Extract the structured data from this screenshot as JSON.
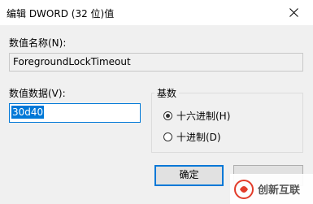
{
  "window": {
    "title": "编辑 DWORD (32 位)值",
    "close_icon": "close-icon"
  },
  "value_name": {
    "label": "数值名称(N):",
    "value": "ForegroundLockTimeout"
  },
  "value_data": {
    "label": "数值数据(V):",
    "value": "30d40"
  },
  "base": {
    "title": "基数",
    "options": [
      {
        "label": "十六进制(H)",
        "selected": true
      },
      {
        "label": "十进制(D)",
        "selected": false
      }
    ]
  },
  "buttons": {
    "ok_label": "确定"
  },
  "watermark": {
    "text": "创新互联"
  },
  "colors": {
    "accent": "#0078d7",
    "dialog_bg": "#f0f0f0",
    "title_bg": "#ffffff"
  }
}
